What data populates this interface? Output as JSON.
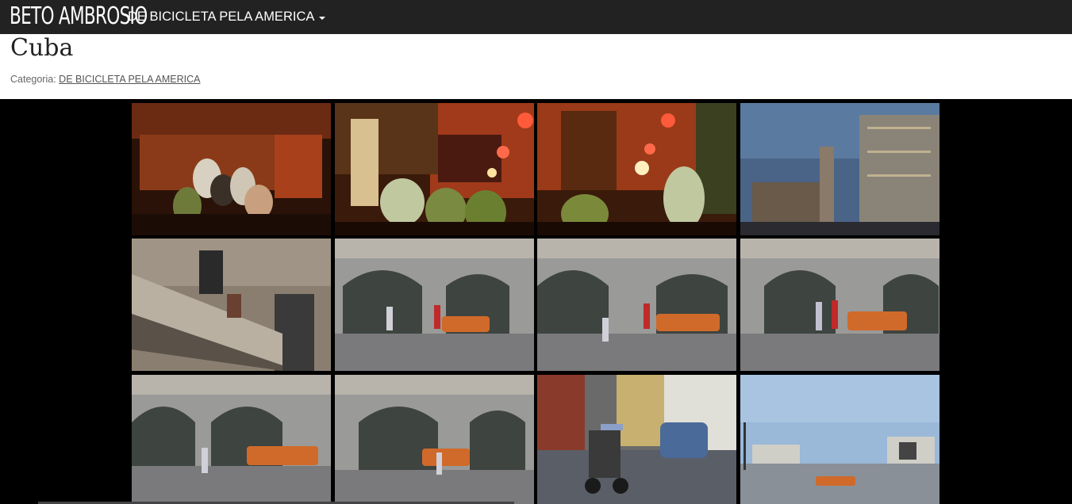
{
  "navbar": {
    "brand": "BETO AMBROSIO",
    "menu_label": "DE BICICLETA PELA AMERICA"
  },
  "post": {
    "title": "Cuba",
    "category_prefix": "Categoria:",
    "category_link": "DE BICICLETA PELA AMERICA"
  },
  "gallery": {
    "photos": [
      {
        "subject": "group-bar-photo"
      },
      {
        "subject": "bar-lamps-photo"
      },
      {
        "subject": "bar-singer-photo"
      },
      {
        "subject": "plaza-dusk-photo"
      },
      {
        "subject": "balcony-photo"
      },
      {
        "subject": "street-football-photo"
      },
      {
        "subject": "street-football-photo"
      },
      {
        "subject": "street-football-photo"
      },
      {
        "subject": "street-football-photo"
      },
      {
        "subject": "street-football-photo"
      },
      {
        "subject": "bicitaxi-street-photo"
      },
      {
        "subject": "revolution-square-photo"
      }
    ]
  }
}
